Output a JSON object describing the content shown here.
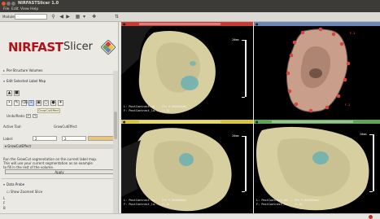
{
  "window": {
    "title": "NIRFASTSlicer 1.0"
  },
  "menu": [
    "File",
    "Edit",
    "View",
    "Help"
  ],
  "toolbar": {
    "module_label": "Modules:",
    "module_value": ""
  },
  "logo": {
    "part1": "NIRFAST",
    "part2": "Slicer"
  },
  "left_panel": {
    "per_structure": "Per-Structure Volumes",
    "edit_selected": "Edit Selected Label Map",
    "tooltip": "GrowCutEffect",
    "undo_redo": "Undo/Redo:",
    "active_tool_label": "Active Tool:",
    "active_tool_value": "GrowCutEffect",
    "label_label": "Label:",
    "label_value": "2",
    "label_value2": "2",
    "section": "GrowCutEffect",
    "help_lines": [
      "Run the GrowCut segmentation on the current label map.",
      "This will use your current segmentation as an example",
      "to fill in the rest of the volume."
    ],
    "apply": "Apply",
    "data_probe": "Data Probe",
    "show_zoomed": "Show Zoomed Slice",
    "probe_lines": [
      "L",
      "F",
      "B"
    ]
  },
  "views": {
    "red": {
      "labels": [
        "L: PostContrast.hd... (Fo 9.000000mm)",
        "F: PostContrast_la... (1.0)"
      ],
      "ruler": "20mm"
    },
    "yellow": {
      "labels": [
        "L: PostContrast.hd... (Fo 9.000000mm)",
        "F: PostContrast_la... (1.0)"
      ],
      "ruler": "20mm"
    },
    "green": {
      "labels": [
        "L: PostContrast.hd... (Fo 9.000000mm)",
        "F: PostContrast_la... (1.0)"
      ],
      "ruler": "20mm"
    },
    "three_d": {
      "markers": [
        "F-1",
        "F-2"
      ]
    }
  },
  "colors": {
    "red": "#c93a34",
    "yellow": "#d8c53b",
    "green": "#5fa552",
    "blue": "#6a86b8",
    "tissue": "#d8cfa0",
    "tumor": "#6fb3b0",
    "model3d": "#c99f8b",
    "marker": "#d04840"
  }
}
